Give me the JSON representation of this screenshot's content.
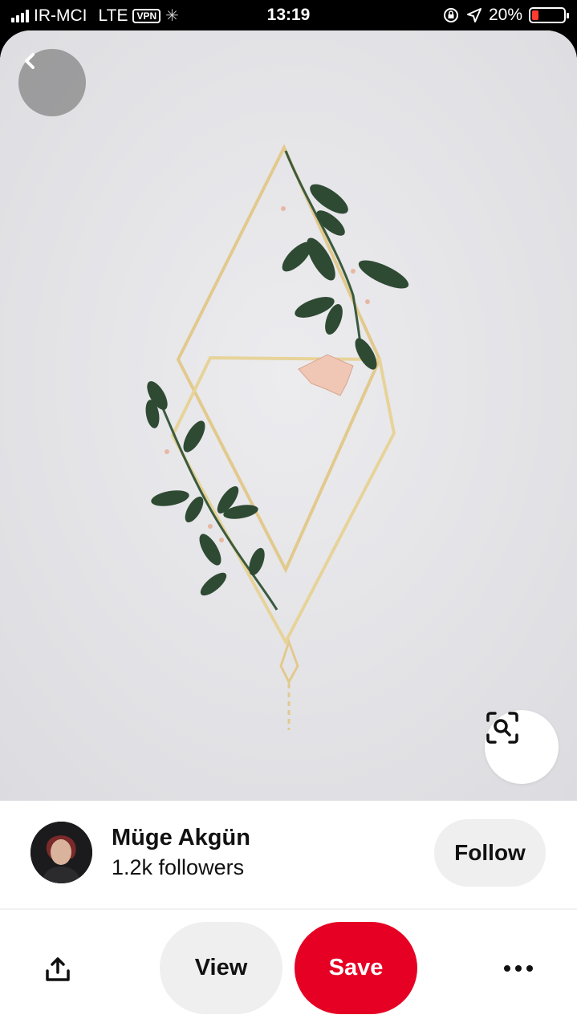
{
  "status_bar": {
    "carrier": "IR-MCI",
    "network": "LTE",
    "vpn": "VPN",
    "time": "13:19",
    "battery_percent": "20%",
    "battery_level": 0.2,
    "battery_color": "#ff3b30"
  },
  "pin": {
    "back_icon": "chevron-left-icon",
    "visual_search_icon": "visual-search-icon"
  },
  "creator": {
    "name": "Müge Akgün",
    "followers": "1.2k followers",
    "follow_label": "Follow"
  },
  "actions": {
    "share_icon": "share-icon",
    "view_label": "View",
    "save_label": "Save",
    "more_icon": "more-icon",
    "save_color": "#e60023"
  }
}
